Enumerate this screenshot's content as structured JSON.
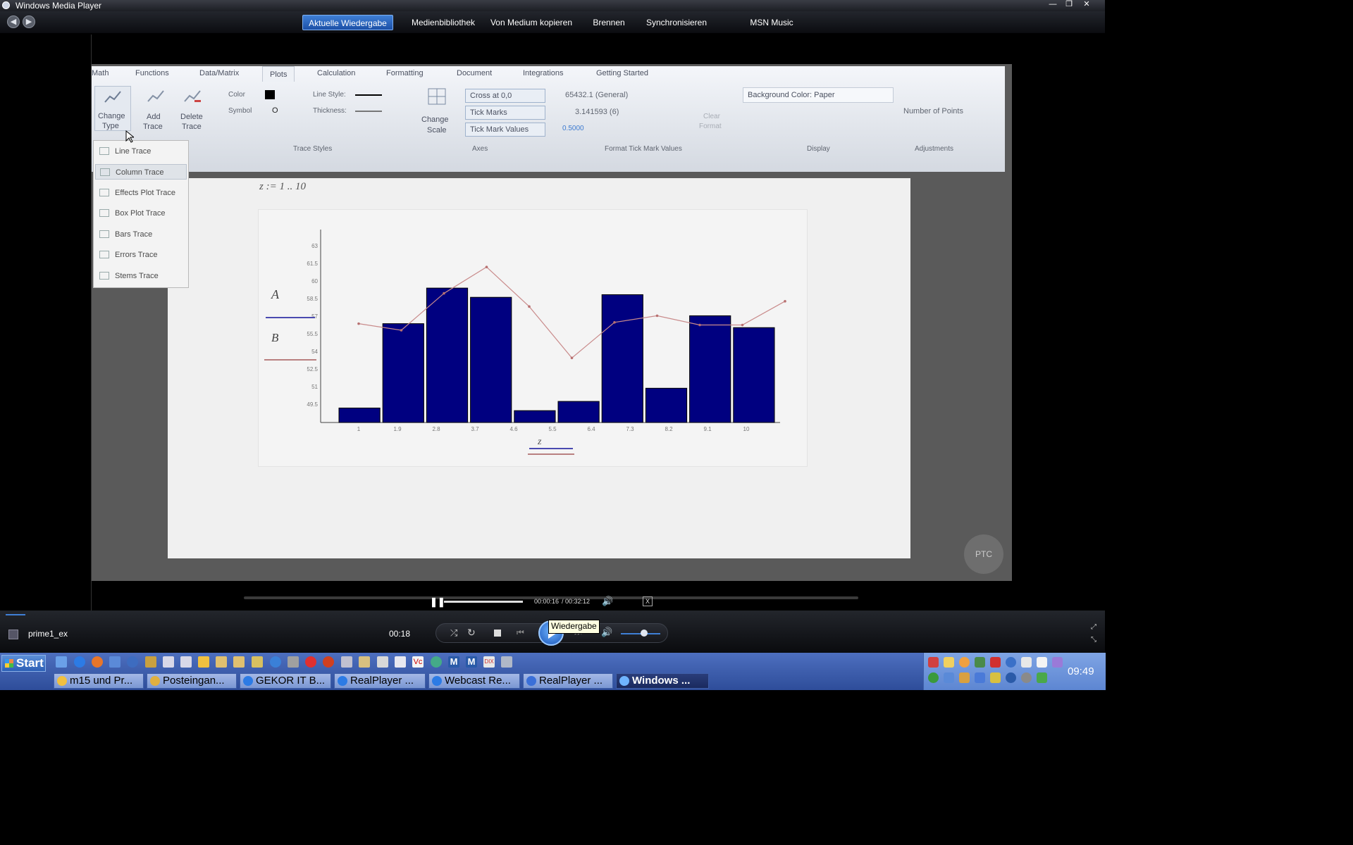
{
  "window": {
    "title": "Windows Media Player"
  },
  "nav": {
    "tabs": [
      "Aktuelle Wiedergabe",
      "Medienbibliothek",
      "Von Medium kopieren",
      "Brennen",
      "Synchronisieren",
      "MSN Music"
    ]
  },
  "video": {
    "ribbon_tabs": [
      "Math",
      "Functions",
      "Data/Matrix",
      "Plots",
      "Calculation",
      "Formatting",
      "Document",
      "Integrations",
      "Getting Started"
    ],
    "ribbon": {
      "change_type": [
        "Change",
        "Type"
      ],
      "add_trace": [
        "Add",
        "Trace"
      ],
      "delete_trace": [
        "Delete",
        "Trace"
      ],
      "color_label": "Color",
      "symbol_label": "Symbol",
      "symbol_value": "O",
      "line_style_label": "Line Style:",
      "thickness_label": "Thickness:",
      "trace_styles_group": "Trace Styles",
      "change_scale": [
        "Change",
        "Scale"
      ],
      "cross_at": "Cross at 0,0",
      "tick_marks": "Tick Marks",
      "tick_mark_values": "Tick Mark Values",
      "axes_group": "Axes",
      "format_general": "65432.1 (General)",
      "format_decimal": "3.141593 (6)",
      "format_small": "0.5000",
      "format_group": "Format Tick Mark Values",
      "clear_format": [
        "Clear",
        "Format"
      ],
      "background_color": "Background Color: Paper",
      "display_group": "Display",
      "number_of_points": "Number of Points",
      "adjustments_group": "Adjustments"
    },
    "dropdown_items": [
      "Line Trace",
      "Column Trace",
      "Effects Plot Trace",
      "Box Plot Trace",
      "Bars Trace",
      "Errors Trace",
      "Stems Trace"
    ],
    "doc_range": "z := 1 .. 10",
    "legend": {
      "a": "A",
      "b": "B"
    },
    "watermark": "PTC",
    "player": {
      "time": "00:00:16",
      "total": "/ 00:32:12"
    }
  },
  "chart_data": {
    "type": "bar",
    "title": "",
    "xlabel": "z",
    "ylabel": "",
    "categories": [
      "1",
      "1.9",
      "2.8",
      "3.7",
      "4.6",
      "5.5",
      "6.4",
      "7.3",
      "8.2",
      "9.1",
      "10"
    ],
    "series": [
      {
        "name": "A",
        "values": [
          49.1,
          55.5,
          58.2,
          57.5,
          48.9,
          49.6,
          57.7,
          50.6,
          56.1,
          55.2
        ]
      },
      {
        "name": "B",
        "values": [
          55.5,
          55.0,
          57.8,
          59.8,
          56.8,
          52.9,
          55.6,
          56.1,
          55.4,
          55.4,
          57.2
        ]
      }
    ],
    "ylim": [
      48,
      62
    ],
    "yticks": [
      "49.5",
      "51",
      "52.5",
      "54",
      "55.5",
      "57",
      "58.5",
      "60",
      "61.5",
      "63"
    ],
    "grid": false
  },
  "controls": {
    "track": "prime1_ex",
    "time": "00:18",
    "tooltip": "Wiedergabe"
  },
  "taskbar": {
    "start": "Start",
    "tasks": [
      "m15 und Pr...",
      "Posteingan...",
      "GEKOR IT B...",
      "RealPlayer ...",
      "Webcast Re...",
      "RealPlayer ...",
      "Windows ..."
    ],
    "clock": "09:49"
  },
  "colors": {
    "bar": "#000080",
    "line": "#c98b8b",
    "accent": "#3f7fd6"
  }
}
